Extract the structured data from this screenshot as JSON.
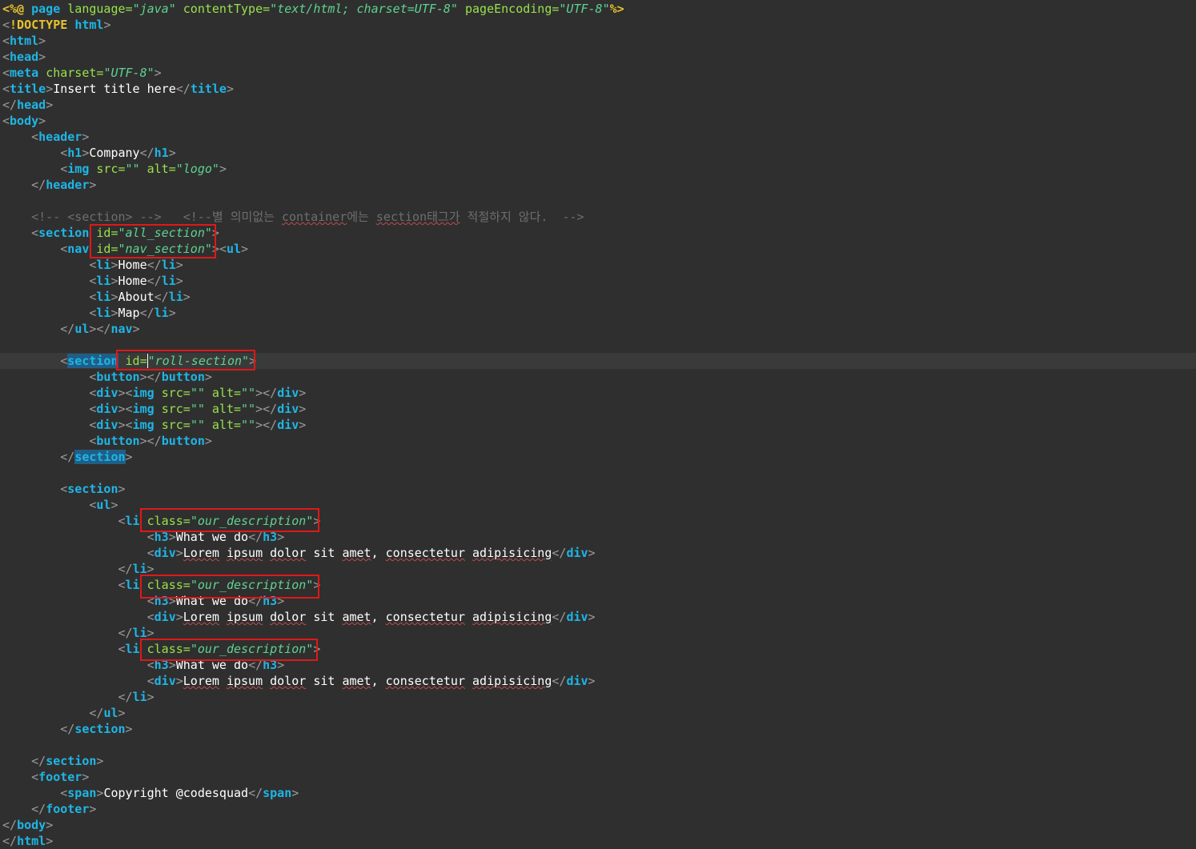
{
  "lines": [
    [
      [
        "dir",
        "<%@ "
      ],
      [
        "tag",
        "page "
      ],
      [
        "attr",
        "language="
      ],
      [
        "str",
        "\"java\" "
      ],
      [
        "attr",
        "contentType="
      ],
      [
        "str",
        "\"text/html; charset=UTF-8\" "
      ],
      [
        "attr",
        "pageEncoding="
      ],
      [
        "str",
        "\"UTF-8\""
      ],
      [
        "dir",
        "%>"
      ]
    ],
    [
      [
        "br",
        "<"
      ],
      [
        "dir",
        "!DOCTYPE "
      ],
      [
        "tag",
        "html"
      ],
      [
        "br",
        ">"
      ]
    ],
    [
      [
        "br",
        "<"
      ],
      [
        "tag",
        "html"
      ],
      [
        "br",
        ">"
      ]
    ],
    [
      [
        "br",
        "<"
      ],
      [
        "tag",
        "head"
      ],
      [
        "br",
        ">"
      ]
    ],
    [
      [
        "br",
        "<"
      ],
      [
        "tag",
        "meta "
      ],
      [
        "attr",
        "charset="
      ],
      [
        "str",
        "\"UTF-8\""
      ],
      [
        "br",
        ">"
      ]
    ],
    [
      [
        "br",
        "<"
      ],
      [
        "tag",
        "title"
      ],
      [
        "br",
        ">"
      ],
      [
        "txt",
        "Insert title here"
      ],
      [
        "br",
        "</"
      ],
      [
        "tag",
        "title"
      ],
      [
        "br",
        ">"
      ]
    ],
    [
      [
        "br",
        "</"
      ],
      [
        "tag",
        "head"
      ],
      [
        "br",
        ">"
      ]
    ],
    [
      [
        "br",
        "<"
      ],
      [
        "tag",
        "body"
      ],
      [
        "br",
        ">"
      ]
    ],
    [
      [
        "txt",
        "    "
      ],
      [
        "br",
        "<"
      ],
      [
        "tag",
        "header"
      ],
      [
        "br",
        ">"
      ]
    ],
    [
      [
        "txt",
        "        "
      ],
      [
        "br",
        "<"
      ],
      [
        "tag",
        "h1"
      ],
      [
        "br",
        ">"
      ],
      [
        "txt",
        "Company"
      ],
      [
        "br",
        "</"
      ],
      [
        "tag",
        "h1"
      ],
      [
        "br",
        ">"
      ]
    ],
    [
      [
        "txt",
        "        "
      ],
      [
        "br",
        "<"
      ],
      [
        "tag",
        "img "
      ],
      [
        "attr",
        "src="
      ],
      [
        "str",
        "\"\" "
      ],
      [
        "attr",
        "alt="
      ],
      [
        "str",
        "\"logo\""
      ],
      [
        "br",
        ">"
      ]
    ],
    [
      [
        "txt",
        "    "
      ],
      [
        "br",
        "</"
      ],
      [
        "tag",
        "header"
      ],
      [
        "br",
        ">"
      ]
    ],
    [],
    [
      [
        "txt",
        "    "
      ],
      [
        "cmt",
        "<!-- <section> -->   <!--별 의미없는 "
      ],
      [
        "cmt spell",
        "container"
      ],
      [
        "cmt",
        "에는 "
      ],
      [
        "cmt spell",
        "section태그가"
      ],
      [
        "cmt",
        " 적절하지 않다.  -->"
      ]
    ],
    [
      [
        "txt",
        "    "
      ],
      [
        "br",
        "<"
      ],
      [
        "tag",
        "section "
      ],
      [
        "attr",
        "id="
      ],
      [
        "str",
        "\"all_section\""
      ],
      [
        "br",
        ">"
      ]
    ],
    [
      [
        "txt",
        "        "
      ],
      [
        "br",
        "<"
      ],
      [
        "tag",
        "nav "
      ],
      [
        "attr",
        "id="
      ],
      [
        "str",
        "\"nav_section\""
      ],
      [
        "br",
        ">"
      ],
      [
        "br",
        "<"
      ],
      [
        "tag",
        "ul"
      ],
      [
        "br",
        ">"
      ]
    ],
    [
      [
        "txt",
        "            "
      ],
      [
        "br",
        "<"
      ],
      [
        "tag",
        "li"
      ],
      [
        "br",
        ">"
      ],
      [
        "txt",
        "Home"
      ],
      [
        "br",
        "</"
      ],
      [
        "tag",
        "li"
      ],
      [
        "br",
        ">"
      ]
    ],
    [
      [
        "txt",
        "            "
      ],
      [
        "br",
        "<"
      ],
      [
        "tag",
        "li"
      ],
      [
        "br",
        ">"
      ],
      [
        "txt",
        "Home"
      ],
      [
        "br",
        "</"
      ],
      [
        "tag",
        "li"
      ],
      [
        "br",
        ">"
      ]
    ],
    [
      [
        "txt",
        "            "
      ],
      [
        "br",
        "<"
      ],
      [
        "tag",
        "li"
      ],
      [
        "br",
        ">"
      ],
      [
        "txt",
        "About"
      ],
      [
        "br",
        "</"
      ],
      [
        "tag",
        "li"
      ],
      [
        "br",
        ">"
      ]
    ],
    [
      [
        "txt",
        "            "
      ],
      [
        "br",
        "<"
      ],
      [
        "tag",
        "li"
      ],
      [
        "br",
        ">"
      ],
      [
        "txt",
        "Map"
      ],
      [
        "br",
        "</"
      ],
      [
        "tag",
        "li"
      ],
      [
        "br",
        ">"
      ]
    ],
    [
      [
        "txt",
        "        "
      ],
      [
        "br",
        "</"
      ],
      [
        "tag",
        "ul"
      ],
      [
        "br",
        "></"
      ],
      [
        "tag",
        "nav"
      ],
      [
        "br",
        ">"
      ]
    ],
    [],
    [
      [
        "txt",
        "        "
      ],
      [
        "br",
        "<"
      ],
      [
        "tag hl",
        "section"
      ],
      [
        "txt",
        " "
      ],
      [
        "attr",
        "id="
      ],
      [
        "str caret",
        "\"roll-section\""
      ],
      [
        "br",
        ">"
      ]
    ],
    [
      [
        "txt",
        "            "
      ],
      [
        "br",
        "<"
      ],
      [
        "tag",
        "button"
      ],
      [
        "br",
        "></"
      ],
      [
        "tag",
        "button"
      ],
      [
        "br",
        ">"
      ]
    ],
    [
      [
        "txt",
        "            "
      ],
      [
        "br",
        "<"
      ],
      [
        "tag",
        "div"
      ],
      [
        "br",
        "><"
      ],
      [
        "tag",
        "img "
      ],
      [
        "attr",
        "src="
      ],
      [
        "str",
        "\"\" "
      ],
      [
        "attr",
        "alt="
      ],
      [
        "str",
        "\"\""
      ],
      [
        "br",
        "></"
      ],
      [
        "tag",
        "div"
      ],
      [
        "br",
        ">"
      ]
    ],
    [
      [
        "txt",
        "            "
      ],
      [
        "br",
        "<"
      ],
      [
        "tag",
        "div"
      ],
      [
        "br",
        "><"
      ],
      [
        "tag",
        "img "
      ],
      [
        "attr",
        "src="
      ],
      [
        "str",
        "\"\" "
      ],
      [
        "attr",
        "alt="
      ],
      [
        "str",
        "\"\""
      ],
      [
        "br",
        "></"
      ],
      [
        "tag",
        "div"
      ],
      [
        "br",
        ">"
      ]
    ],
    [
      [
        "txt",
        "            "
      ],
      [
        "br",
        "<"
      ],
      [
        "tag",
        "div"
      ],
      [
        "br",
        "><"
      ],
      [
        "tag",
        "img "
      ],
      [
        "attr",
        "src="
      ],
      [
        "str",
        "\"\" "
      ],
      [
        "attr",
        "alt="
      ],
      [
        "str",
        "\"\""
      ],
      [
        "br",
        "></"
      ],
      [
        "tag",
        "div"
      ],
      [
        "br",
        ">"
      ]
    ],
    [
      [
        "txt",
        "            "
      ],
      [
        "br",
        "<"
      ],
      [
        "tag",
        "button"
      ],
      [
        "br",
        "></"
      ],
      [
        "tag",
        "button"
      ],
      [
        "br",
        ">"
      ]
    ],
    [
      [
        "txt",
        "        "
      ],
      [
        "br",
        "</"
      ],
      [
        "tag hl",
        "section"
      ],
      [
        "br",
        ">"
      ]
    ],
    [],
    [
      [
        "txt",
        "        "
      ],
      [
        "br",
        "<"
      ],
      [
        "tag",
        "section"
      ],
      [
        "br",
        ">"
      ]
    ],
    [
      [
        "txt",
        "            "
      ],
      [
        "br",
        "<"
      ],
      [
        "tag",
        "ul"
      ],
      [
        "br",
        ">"
      ]
    ],
    [
      [
        "txt",
        "                "
      ],
      [
        "br",
        "<"
      ],
      [
        "tag",
        "li "
      ],
      [
        "attr",
        "class="
      ],
      [
        "str",
        "\"our_description\""
      ],
      [
        "br",
        ">"
      ]
    ],
    [
      [
        "txt",
        "                    "
      ],
      [
        "br",
        "<"
      ],
      [
        "tag",
        "h3"
      ],
      [
        "br",
        ">"
      ],
      [
        "txt",
        "What we do"
      ],
      [
        "br",
        "</"
      ],
      [
        "tag",
        "h3"
      ],
      [
        "br",
        ">"
      ]
    ],
    [
      [
        "txt",
        "                    "
      ],
      [
        "br",
        "<"
      ],
      [
        "tag",
        "div"
      ],
      [
        "br",
        ">"
      ],
      [
        "txt spell",
        "Lorem"
      ],
      [
        "txt",
        " "
      ],
      [
        "txt spell",
        "ipsum"
      ],
      [
        "txt",
        " "
      ],
      [
        "txt spell",
        "dolor"
      ],
      [
        "txt",
        " sit "
      ],
      [
        "txt spell",
        "amet"
      ],
      [
        "txt",
        ", "
      ],
      [
        "txt spell",
        "consectetur"
      ],
      [
        "txt",
        " "
      ],
      [
        "txt spell",
        "adipisicing"
      ],
      [
        "br",
        "</"
      ],
      [
        "tag",
        "div"
      ],
      [
        "br",
        ">"
      ]
    ],
    [
      [
        "txt",
        "                "
      ],
      [
        "br",
        "</"
      ],
      [
        "tag",
        "li"
      ],
      [
        "br",
        ">"
      ]
    ],
    [
      [
        "txt",
        "                "
      ],
      [
        "br",
        "<"
      ],
      [
        "tag",
        "li "
      ],
      [
        "attr",
        "class="
      ],
      [
        "str",
        "\"our_description\""
      ],
      [
        "br",
        ">"
      ]
    ],
    [
      [
        "txt",
        "                    "
      ],
      [
        "br",
        "<"
      ],
      [
        "tag",
        "h3"
      ],
      [
        "br",
        ">"
      ],
      [
        "txt",
        "What we do"
      ],
      [
        "br",
        "</"
      ],
      [
        "tag",
        "h3"
      ],
      [
        "br",
        ">"
      ]
    ],
    [
      [
        "txt",
        "                    "
      ],
      [
        "br",
        "<"
      ],
      [
        "tag",
        "div"
      ],
      [
        "br",
        ">"
      ],
      [
        "txt spell",
        "Lorem"
      ],
      [
        "txt",
        " "
      ],
      [
        "txt spell",
        "ipsum"
      ],
      [
        "txt",
        " "
      ],
      [
        "txt spell",
        "dolor"
      ],
      [
        "txt",
        " sit "
      ],
      [
        "txt spell",
        "amet"
      ],
      [
        "txt",
        ", "
      ],
      [
        "txt spell",
        "consectetur"
      ],
      [
        "txt",
        " "
      ],
      [
        "txt spell",
        "adipisicing"
      ],
      [
        "br",
        "</"
      ],
      [
        "tag",
        "div"
      ],
      [
        "br",
        ">"
      ]
    ],
    [
      [
        "txt",
        "                "
      ],
      [
        "br",
        "</"
      ],
      [
        "tag",
        "li"
      ],
      [
        "br",
        ">"
      ]
    ],
    [
      [
        "txt",
        "                "
      ],
      [
        "br",
        "<"
      ],
      [
        "tag",
        "li "
      ],
      [
        "attr",
        "class="
      ],
      [
        "str",
        "\"our_description\""
      ],
      [
        "br",
        ">"
      ]
    ],
    [
      [
        "txt",
        "                    "
      ],
      [
        "br",
        "<"
      ],
      [
        "tag",
        "h3"
      ],
      [
        "br",
        ">"
      ],
      [
        "txt",
        "What we do"
      ],
      [
        "br",
        "</"
      ],
      [
        "tag",
        "h3"
      ],
      [
        "br",
        ">"
      ]
    ],
    [
      [
        "txt",
        "                    "
      ],
      [
        "br",
        "<"
      ],
      [
        "tag",
        "div"
      ],
      [
        "br",
        ">"
      ],
      [
        "txt spell",
        "Lorem"
      ],
      [
        "txt",
        " "
      ],
      [
        "txt spell",
        "ipsum"
      ],
      [
        "txt",
        " "
      ],
      [
        "txt spell",
        "dolor"
      ],
      [
        "txt",
        " sit "
      ],
      [
        "txt spell",
        "amet"
      ],
      [
        "txt",
        ", "
      ],
      [
        "txt spell",
        "consectetur"
      ],
      [
        "txt",
        " "
      ],
      [
        "txt spell",
        "adipisicing"
      ],
      [
        "br",
        "</"
      ],
      [
        "tag",
        "div"
      ],
      [
        "br",
        ">"
      ]
    ],
    [
      [
        "txt",
        "                "
      ],
      [
        "br",
        "</"
      ],
      [
        "tag",
        "li"
      ],
      [
        "br",
        ">"
      ]
    ],
    [
      [
        "txt",
        "            "
      ],
      [
        "br",
        "</"
      ],
      [
        "tag",
        "ul"
      ],
      [
        "br",
        ">"
      ]
    ],
    [
      [
        "txt",
        "        "
      ],
      [
        "br",
        "</"
      ],
      [
        "tag",
        "section"
      ],
      [
        "br",
        ">"
      ]
    ],
    [],
    [
      [
        "txt",
        "    "
      ],
      [
        "br",
        "</"
      ],
      [
        "tag",
        "section"
      ],
      [
        "br",
        ">"
      ]
    ],
    [
      [
        "txt",
        "    "
      ],
      [
        "br",
        "<"
      ],
      [
        "tag",
        "footer"
      ],
      [
        "br",
        ">"
      ]
    ],
    [
      [
        "txt",
        "        "
      ],
      [
        "br",
        "<"
      ],
      [
        "tag",
        "span"
      ],
      [
        "br",
        ">"
      ],
      [
        "txt",
        "Copyright @codesquad"
      ],
      [
        "br",
        "</"
      ],
      [
        "tag",
        "span"
      ],
      [
        "br",
        ">"
      ]
    ],
    [
      [
        "txt",
        "    "
      ],
      [
        "br",
        "</"
      ],
      [
        "tag",
        "footer"
      ],
      [
        "br",
        ">"
      ]
    ],
    [
      [
        "br",
        "</"
      ],
      [
        "tag",
        "body"
      ],
      [
        "br",
        ">"
      ]
    ],
    [
      [
        "br",
        "</"
      ],
      [
        "tag",
        "html"
      ],
      [
        "br",
        ">"
      ]
    ]
  ],
  "current_line": 22,
  "colors": {
    "background": "#2f2f2f",
    "tag": "#1eb6e6",
    "attribute": "#98e24c",
    "string": "#5fd38f",
    "directive": "#e8c22e",
    "comment": "#6e6e6e",
    "annotation_box": "#e01818"
  }
}
